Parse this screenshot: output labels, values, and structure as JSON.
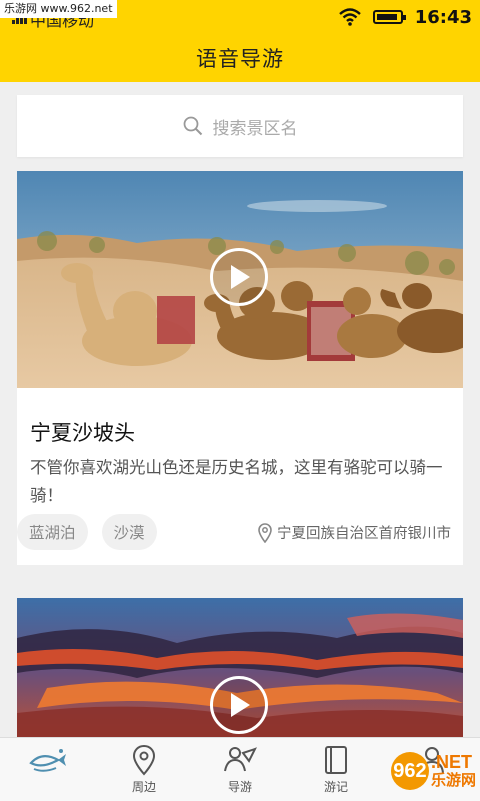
{
  "status_bar": {
    "watermark": "乐游网 www.962.net",
    "carrier": "中国移动",
    "time": "16:43",
    "background": "#ffd400"
  },
  "header": {
    "title": "语音导游"
  },
  "search": {
    "placeholder": "搜索景区名",
    "icon": "search-icon"
  },
  "cards": [
    {
      "title": "宁夏沙坡头",
      "description": "不管你喜欢湖光山色还是历史名城，这里有骆驼可以骑一骑！",
      "tags": [
        "蓝湖泊",
        "沙漠"
      ],
      "location": "宁夏回族自治区首府银川市",
      "image": "desert-camels-photo"
    },
    {
      "image": "sunset-clouds-photo"
    }
  ],
  "tabbar": {
    "tabs": [
      {
        "label": "",
        "icon": "fish-logo-icon"
      },
      {
        "label": "周边",
        "icon": "location-pin-icon"
      },
      {
        "label": "导游",
        "icon": "guide-person-icon"
      },
      {
        "label": "游记",
        "icon": "notebook-icon"
      },
      {
        "label": "",
        "icon": "profile-icon"
      }
    ]
  },
  "brand_watermark": {
    "number": "962",
    "net": ".NET",
    "cn": "乐游网"
  }
}
